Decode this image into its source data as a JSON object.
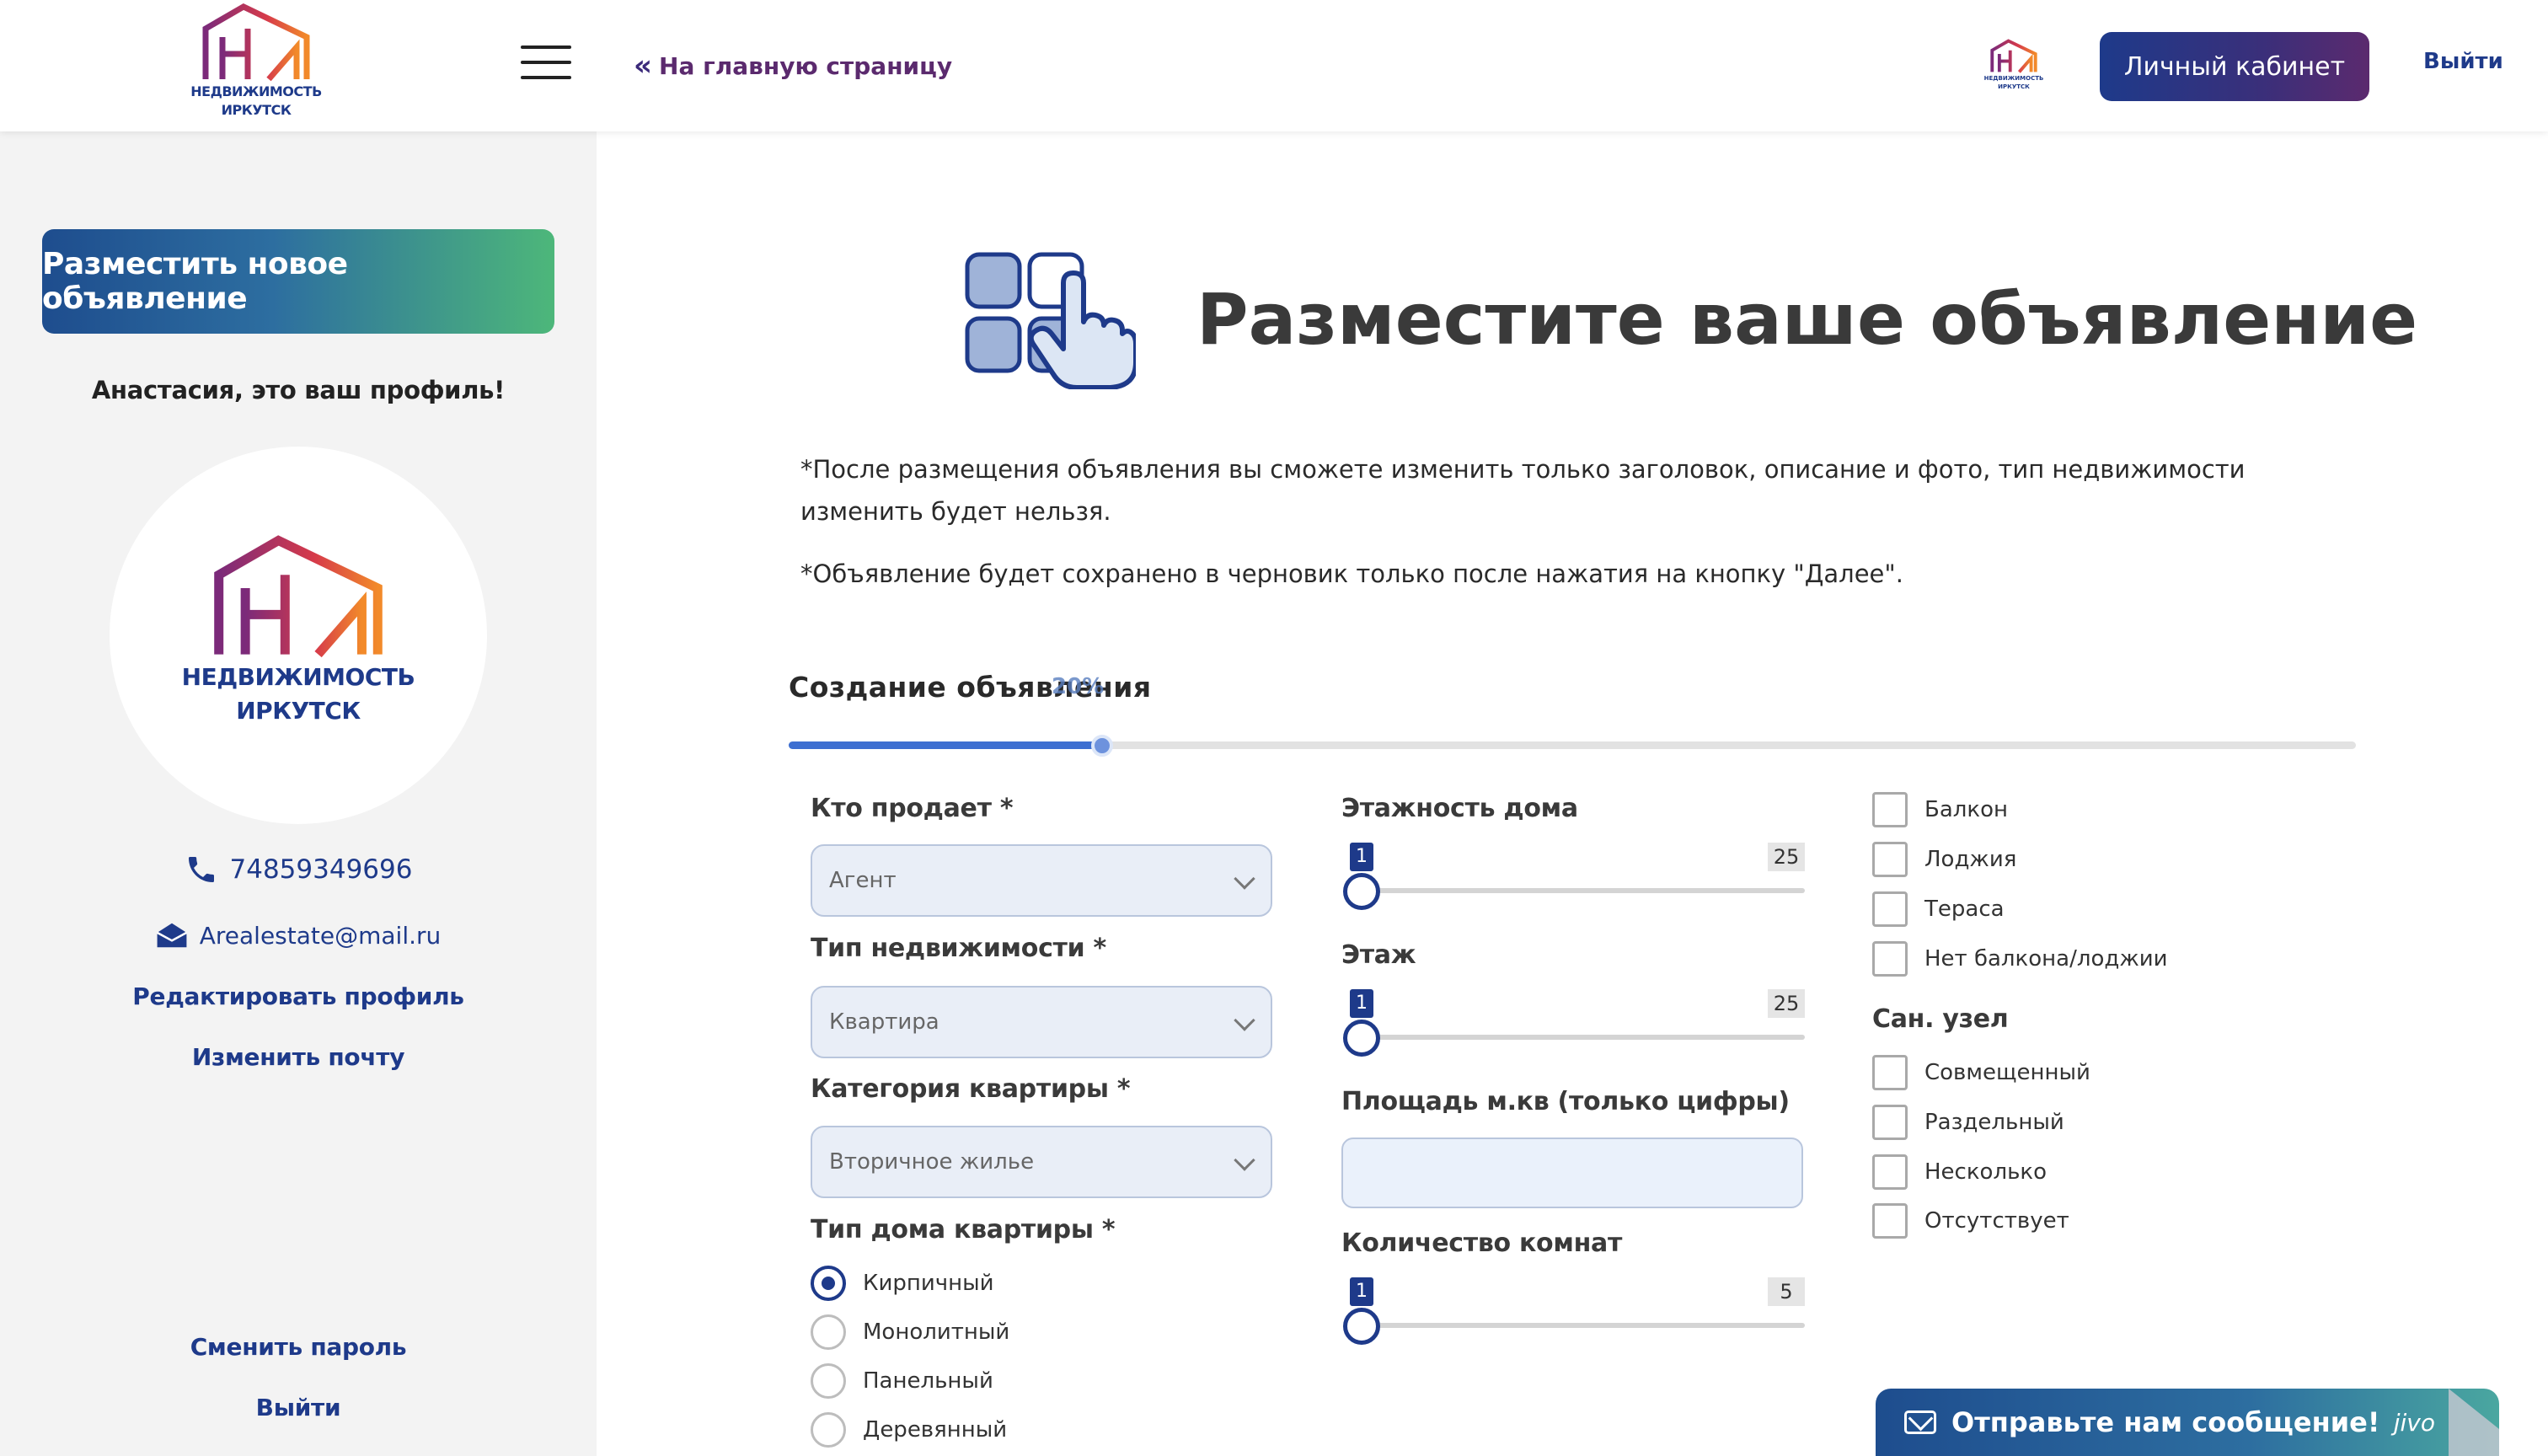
{
  "header": {
    "logo_line1": "НЕДВИЖИМОСТЬ",
    "logo_line2": "ИРКУТСК",
    "home_link": "На главную страницу",
    "home_link_icon": "double-chevron-left-icon",
    "menu_icon": "hamburger-menu-icon",
    "cabinet_button": "Личный кабинет",
    "logout": "Выйти"
  },
  "sidebar": {
    "new_ad_button": "Разместить новое объявление",
    "greeting": "Анастасия, это ваш профиль!",
    "avatar_line1": "НЕДВИЖИМОСТЬ",
    "avatar_line2": "ИРКУТСК",
    "phone": "74859349696",
    "email": "Arealestate@mail.ru",
    "edit_profile": "Редактировать профиль",
    "change_email": "Изменить почту",
    "change_password": "Сменить пароль",
    "logout": "Выйти"
  },
  "main": {
    "title": "Разместите ваше объявление",
    "note1": "*После размещения объявления вы сможете изменить только заголовок, описание и фото, тип недвижимости изменить будет нельзя.",
    "note2": "*Объявление будет сохранено в черновик только после нажатия на кнопку \"Далее\".",
    "section_title": "Создание объявления",
    "progress_label": "20%",
    "progress_fraction": 0.2
  },
  "form": {
    "seller_label": "Кто продает",
    "seller_value": "Агент",
    "property_type_label": "Тип недвижимости",
    "property_type_value": "Квартира",
    "apartment_category_label": "Категория квартиры",
    "apartment_category_value": "Вторичное жилье",
    "house_type_label": "Тип дома квартиры",
    "house_types": [
      {
        "label": "Кирпичный",
        "checked": true
      },
      {
        "label": "Монолитный",
        "checked": false
      },
      {
        "label": "Панельный",
        "checked": false
      },
      {
        "label": "Деревянный",
        "checked": false
      }
    ],
    "floors_label": "Этажность дома",
    "floors_min": "1",
    "floors_max": "25",
    "floor_label": "Этаж",
    "floor_min": "1",
    "floor_max": "25",
    "area_label": "Площадь м.кв (только цифры)",
    "area_value": "",
    "rooms_label": "Количество комнат",
    "rooms_min": "1",
    "rooms_max": "5",
    "balcony_options": [
      "Балкон",
      "Лоджия",
      "Тераса",
      "Нет балкона/лоджии"
    ],
    "bathroom_label": "Сан. узел",
    "bathroom_options": [
      "Совмещенный",
      "Раздельный",
      "Несколько",
      "Отсутствует"
    ]
  },
  "chat": {
    "label": "Отправьте нам сообщение!",
    "brand": "jivo"
  },
  "colors": {
    "primary": "#1e3a8a",
    "accent_purple": "#5b2a6e",
    "accent_green": "#4db77a",
    "sidebar_bg": "#f3f3f3"
  }
}
